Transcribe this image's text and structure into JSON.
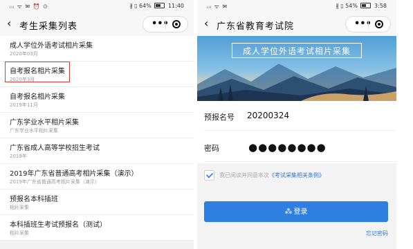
{
  "left_screen": {
    "status": {
      "left": "ᵢₗₗ ᯤ ✉ ⏰ ⏲",
      "right_pre": "∦ ▯ 64%",
      "time": "11:40"
    },
    "nav": {
      "back": "‹",
      "title": "考生采集列表",
      "dots": "•••"
    },
    "items": [
      {
        "title": "成人学位外语考试相片采集",
        "sub": "2020年03月"
      },
      {
        "title": "自考报名相片采集",
        "sub": "2020年3月"
      },
      {
        "title": "自考报名相片采集",
        "sub": "2019年11月"
      },
      {
        "title": "广东学业水平相片采集",
        "sub": "广东学业水平相片采集"
      },
      {
        "title": "广东省成人高等学校招生考试",
        "sub": "2019年"
      },
      {
        "title": "2019年广东省普通高考相片采集（演示）",
        "sub": "2019年广东省普通高考相片采集（演示）"
      },
      {
        "title": "预报名本科插班",
        "sub": "相片采集"
      },
      {
        "title": "本科插班生考试预报名（测试）",
        "sub": "相片采集"
      }
    ]
  },
  "right_screen": {
    "status": {
      "left": "ᵢₗₗ ᯤ ✉",
      "right_pre": "∦ ▯ 54%",
      "time": "3:58"
    },
    "nav": {
      "back": "‹",
      "title": "广东省教育考试院",
      "dots": "•••"
    },
    "banner_title": "成人学位外语考试相片采集",
    "form": {
      "id_label": "预报名号",
      "id_value": "20200324",
      "pw_label": "密码",
      "pw_mask": "●●●●●●●●"
    },
    "agree": {
      "prefix": "我已阅读并同意本次",
      "link": "《考试采集相关条例》"
    },
    "login": {
      "spinner": "⁂",
      "label": "登录"
    },
    "forgot": "忘记密码"
  },
  "colors": {
    "accent_blue": "#2f7fe0",
    "highlight_red": "#e0382b"
  }
}
